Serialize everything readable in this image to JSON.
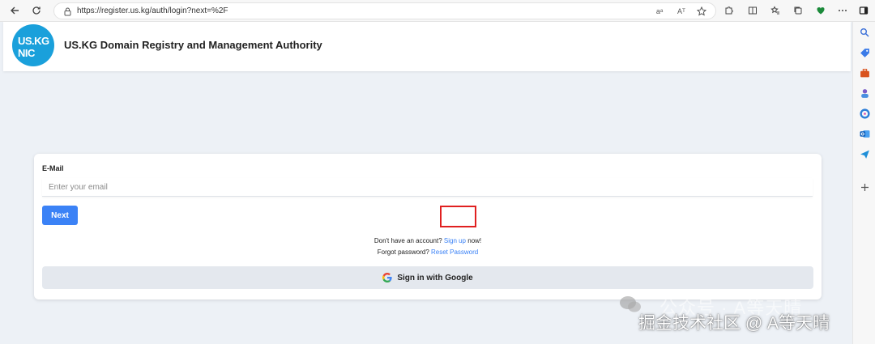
{
  "browser": {
    "url": "https://register.us.kg/auth/login?next=%2F",
    "read_aloud_label": "Aᵀ",
    "translate_label": "aᵃ"
  },
  "header": {
    "logo_line1": "US.KG",
    "logo_line2": "NIC",
    "title": "US.KG Domain Registry and Management Authority"
  },
  "form": {
    "email_label": "E-Mail",
    "email_placeholder": "Enter your email",
    "email_value": "",
    "next_label": "Next",
    "no_account_prefix": "Don't have an account? ",
    "signup_link": "Sign up",
    "no_account_suffix": " now!",
    "forgot_prefix": "Forgot password? ",
    "reset_link": "Reset Password",
    "google_label": "Sign in with Google"
  },
  "watermark": {
    "ghost_text": "公众号 · A等天晴",
    "main_text": "掘金技术社区 @ A等天晴"
  },
  "colors": {
    "accent": "#3b82f6",
    "logo_bg": "#1aa0db",
    "page_bg": "#edf1f6",
    "highlight": "#e02020"
  }
}
